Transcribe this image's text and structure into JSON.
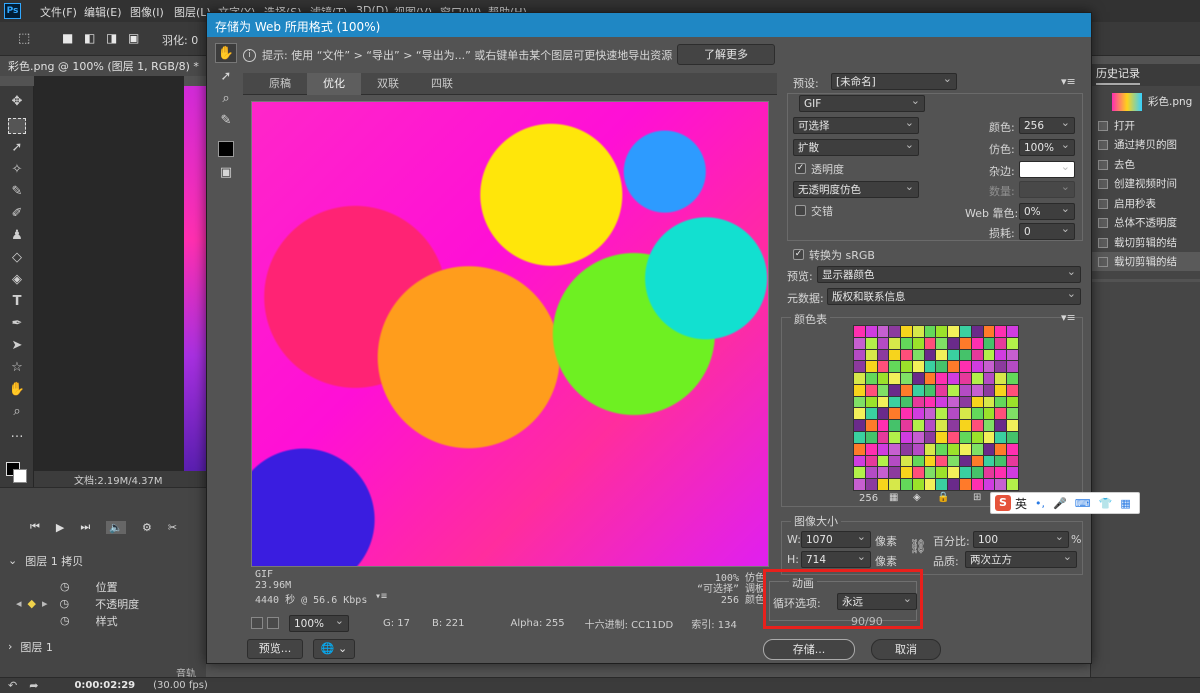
{
  "menubar": {
    "items": [
      "文件(F)",
      "编辑(E)",
      "图像(I)",
      "图层(L)",
      "文字(Y)",
      "选择(S)",
      "滤镜(T)",
      "3D(D)",
      "视图(V)",
      "窗口(W)",
      "帮助(H)"
    ]
  },
  "options": {
    "feather": "羽化: 0"
  },
  "document": {
    "tab": "彩色.png @ 100% (图层 1, RGB/8) *",
    "status": "文档:2.19M/4.37M"
  },
  "timeline": {
    "layer_copy": "图层 1 拷贝",
    "props": [
      "位置",
      "不透明度",
      "样式"
    ],
    "layer": "图层 1",
    "audio": "音轨",
    "time": "0:00:02:29",
    "fps": "(30.00 fps)"
  },
  "history": {
    "title": "历史记录",
    "snapshot": "彩色.png",
    "items": [
      "打开",
      "通过拷贝的图",
      "去色",
      "创建视频时间",
      "启用秒表",
      "总体不透明度",
      "载切剪辑的结",
      "载切剪辑的结"
    ]
  },
  "dialog": {
    "title": "存储为 Web 所用格式 (100%)",
    "hint": "提示: 使用 “文件” > “导出” > “导出为...” 或右键单击某个图层可更快速地导出资源",
    "learn_more": "了解更多",
    "tabs": [
      "原稿",
      "优化",
      "双联",
      "四联"
    ],
    "active_tab": "优化",
    "info": {
      "format": "GIF",
      "size": "23.96M",
      "time": "4440 秒 @ 56.6 Kbps",
      "dither_pct": "100% 仿色",
      "palette_mode": "“可选择” 调板",
      "colors": "256 颜色"
    },
    "zoom": "100%",
    "pixel": {
      "g": "G: 17",
      "b": "B: 221",
      "alpha": "Alpha: 255",
      "hex": "十六进制: CC11DD",
      "index": "索引: 134"
    },
    "preview_btn": "预览...",
    "save_btn": "存储...",
    "cancel_btn": "取消"
  },
  "settings": {
    "preset_label": "预设:",
    "preset_value": "[未命名]",
    "format": "GIF",
    "reduction": "可选择",
    "dither_algo": "扩散",
    "transparency_label": "透明度",
    "transparency_checked": true,
    "trans_dither": "无透明度仿色",
    "interlaced_label": "交错",
    "interlaced_checked": false,
    "colors_label": "颜色:",
    "colors_value": "256",
    "dither_label": "仿色:",
    "dither_value": "100%",
    "matte_label": "杂边:",
    "amount_label": "数量:",
    "web_snap_label": "Web 靠色:",
    "web_snap_value": "0%",
    "lossy_label": "损耗:",
    "lossy_value": "0",
    "srgb_label": "转换为 sRGB",
    "srgb_checked": true,
    "preview_label": "预览:",
    "preview_value": "显示器颜色",
    "metadata_label": "元数据:",
    "metadata_value": "版权和联系信息",
    "color_table_title": "颜色表",
    "color_count": "256",
    "image_size_title": "图像大小",
    "w_label": "W:",
    "w_value": "1070",
    "h_label": "H:",
    "h_value": "714",
    "px_unit": "像素",
    "percent_label": "百分比:",
    "percent_value": "100",
    "percent_unit": "%",
    "quality_label": "品质:",
    "quality_value": "两次立方",
    "animation_title": "动画",
    "loop_label": "循环选项:",
    "loop_value": "永远",
    "frame_counter": "90/90"
  },
  "ime": {
    "logo": "S",
    "lang": "英"
  }
}
